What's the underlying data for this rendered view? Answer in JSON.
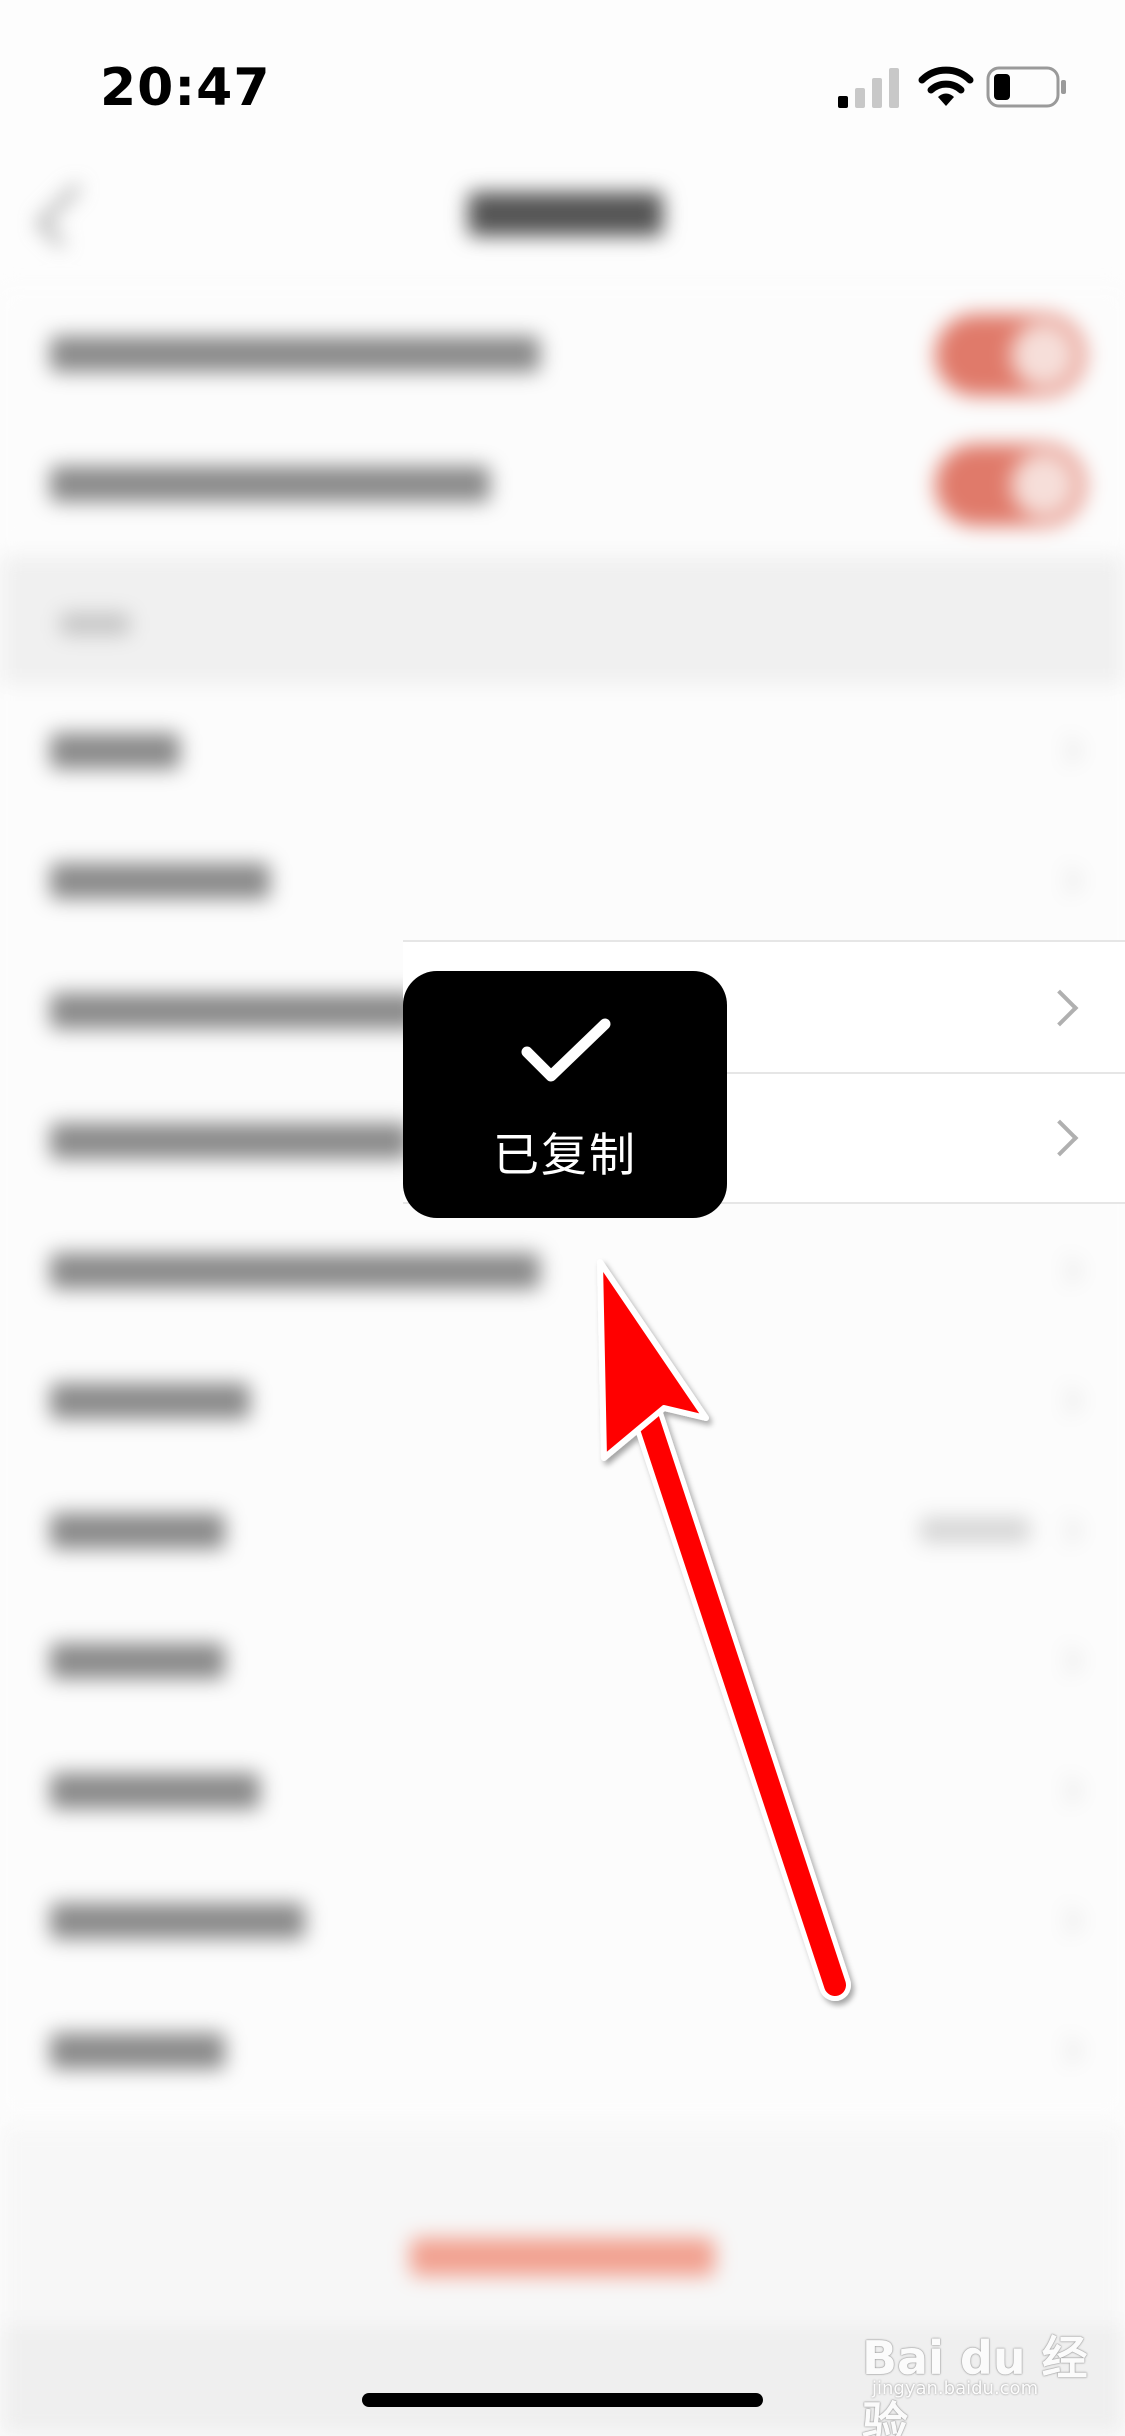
{
  "status_bar": {
    "time": "20:47",
    "icons": [
      "cellular-signal-icon",
      "wifi-icon",
      "battery-icon"
    ]
  },
  "toast": {
    "icon": "checkmark-icon",
    "message": "已复制"
  },
  "annotation": {
    "icon": "arrow-icon",
    "color": "#ff0000"
  },
  "watermark": {
    "brand": "Bai du 经验",
    "sub": "jingyan.baidu.com"
  },
  "colors": {
    "toggle_on": "#e07a6a",
    "toast_bg": "#000000",
    "arrow": "#ff0000"
  }
}
